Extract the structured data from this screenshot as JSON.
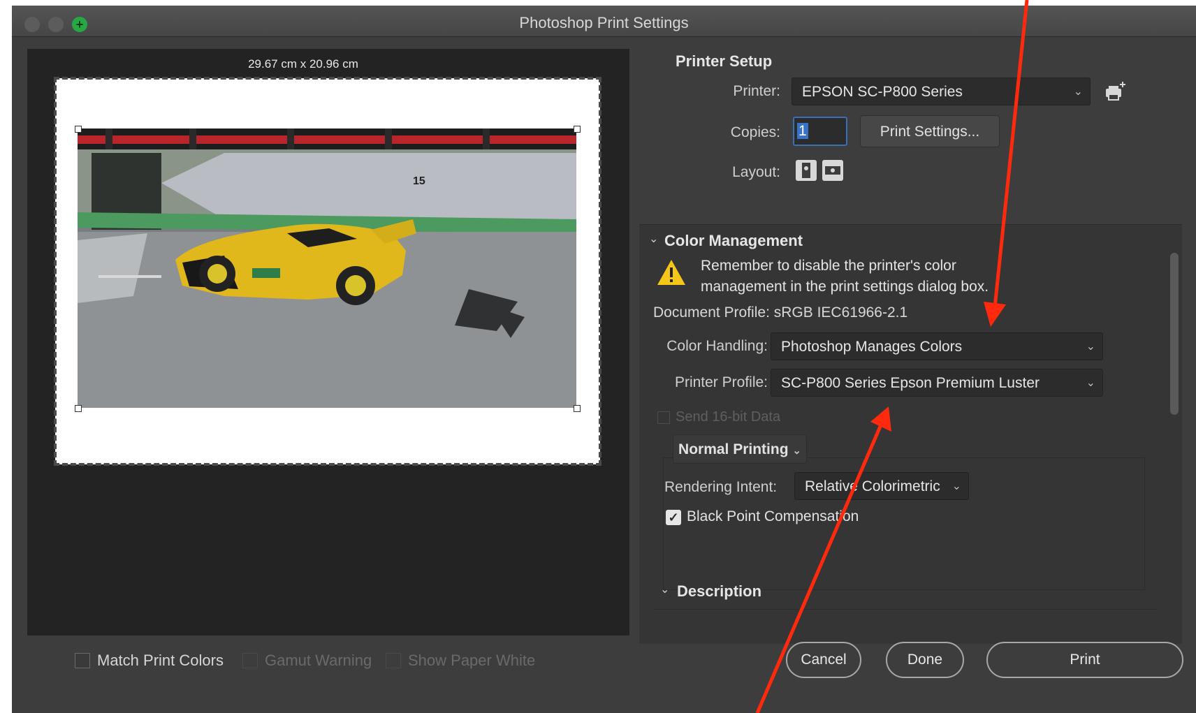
{
  "window": {
    "title": "Photoshop Print Settings"
  },
  "preview": {
    "dimensions": "29.67 cm x 20.96 cm",
    "car_number": "15"
  },
  "bottom_options": [
    {
      "label": "Match Print Colors",
      "enabled": true
    },
    {
      "label": "Gamut Warning",
      "enabled": false
    },
    {
      "label": "Show Paper White",
      "enabled": false
    }
  ],
  "printer_setup": {
    "heading": "Printer Setup",
    "printer_label": "Printer:",
    "printer_value": "EPSON SC-P800 Series",
    "copies_label": "Copies:",
    "copies_value": "1",
    "print_settings_button": "Print Settings...",
    "layout_label": "Layout:"
  },
  "color_management": {
    "heading": "Color Management",
    "warning_line1": "Remember to disable the printer's color",
    "warning_line2": "management in the print settings dialog box.",
    "document_profile": "Document Profile: sRGB IEC61966-2.1",
    "color_handling_label": "Color Handling:",
    "color_handling_value": "Photoshop Manages Colors",
    "printer_profile_label": "Printer Profile:",
    "printer_profile_value": "SC-P800 Series Epson Premium Luster",
    "send_16bit": "Send 16-bit Data",
    "normal_printing": "Normal Printing",
    "rendering_intent_label": "Rendering Intent:",
    "rendering_intent_value": "Relative Colorimetric",
    "black_point": "Black Point Compensation"
  },
  "description": {
    "heading": "Description"
  },
  "buttons": {
    "cancel": "Cancel",
    "done": "Done",
    "print": "Print"
  },
  "colors": {
    "annotation_arrow": "#ff2a0d",
    "window_bg": "#3d3d3d",
    "preview_bg": "#232323"
  }
}
